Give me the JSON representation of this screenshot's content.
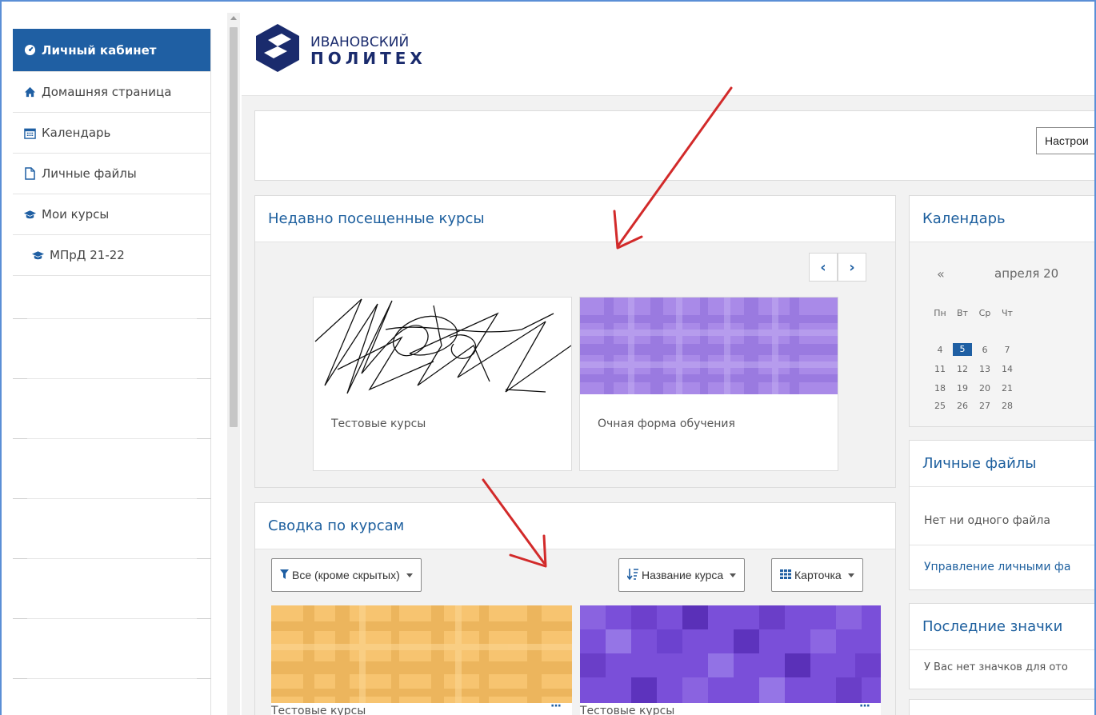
{
  "sidebar": {
    "items": [
      {
        "label": "Личный кабинет",
        "icon": "dashboard-icon",
        "active": true
      },
      {
        "label": "Домашняя страница",
        "icon": "home-icon"
      },
      {
        "label": "Календарь",
        "icon": "calendar-icon"
      },
      {
        "label": "Личные файлы",
        "icon": "file-icon"
      },
      {
        "label": "Мои курсы",
        "icon": "graduation-cap-icon"
      },
      {
        "label": "МПрД 21-22",
        "icon": "graduation-cap-icon"
      }
    ]
  },
  "header": {
    "logo_line1": "ИВАНОВСКИЙ",
    "logo_line2": "ПОЛИТЕХ"
  },
  "toolbar": {
    "customize_label": "Настрои"
  },
  "recent_courses": {
    "title": "Недавно посещенные курсы",
    "prev_label": "‹",
    "next_label": "›",
    "courses": [
      {
        "name": "Тестовые курсы",
        "image": "scribble"
      },
      {
        "name": "Очная форма обучения",
        "image": "purple-plaid"
      }
    ]
  },
  "overview": {
    "title": "Сводка по курсам",
    "filter_label": "Все (кроме скрытых)",
    "sort_label": "Название курса",
    "view_label": "Карточка",
    "courses": [
      {
        "name": "Тестовые курсы",
        "more": "···",
        "image": "orange-plaid"
      },
      {
        "name": "Тестовые курсы",
        "more": "···",
        "image": "purple-squares"
      }
    ]
  },
  "calendar": {
    "title": "Календарь",
    "prev": "«",
    "month": "апреля 20",
    "weekdays": [
      "Пн",
      "Вт",
      "Ср",
      "Чт"
    ],
    "weeks": [
      [
        "4",
        "5",
        "6",
        "7"
      ],
      [
        "11",
        "12",
        "13",
        "14"
      ],
      [
        "18",
        "19",
        "20",
        "21"
      ],
      [
        "25",
        "26",
        "27",
        "28"
      ]
    ],
    "today": "5"
  },
  "files": {
    "title": "Личные файлы",
    "empty": "Нет ни одного файла",
    "manage_link": "Управление личными фа"
  },
  "badges": {
    "title": "Последние значки",
    "empty": "У Вас нет значков для ото"
  },
  "colors": {
    "primary": "#1f5fa3",
    "annotation": "#d22a2a",
    "logo": "#1a2b6d"
  }
}
